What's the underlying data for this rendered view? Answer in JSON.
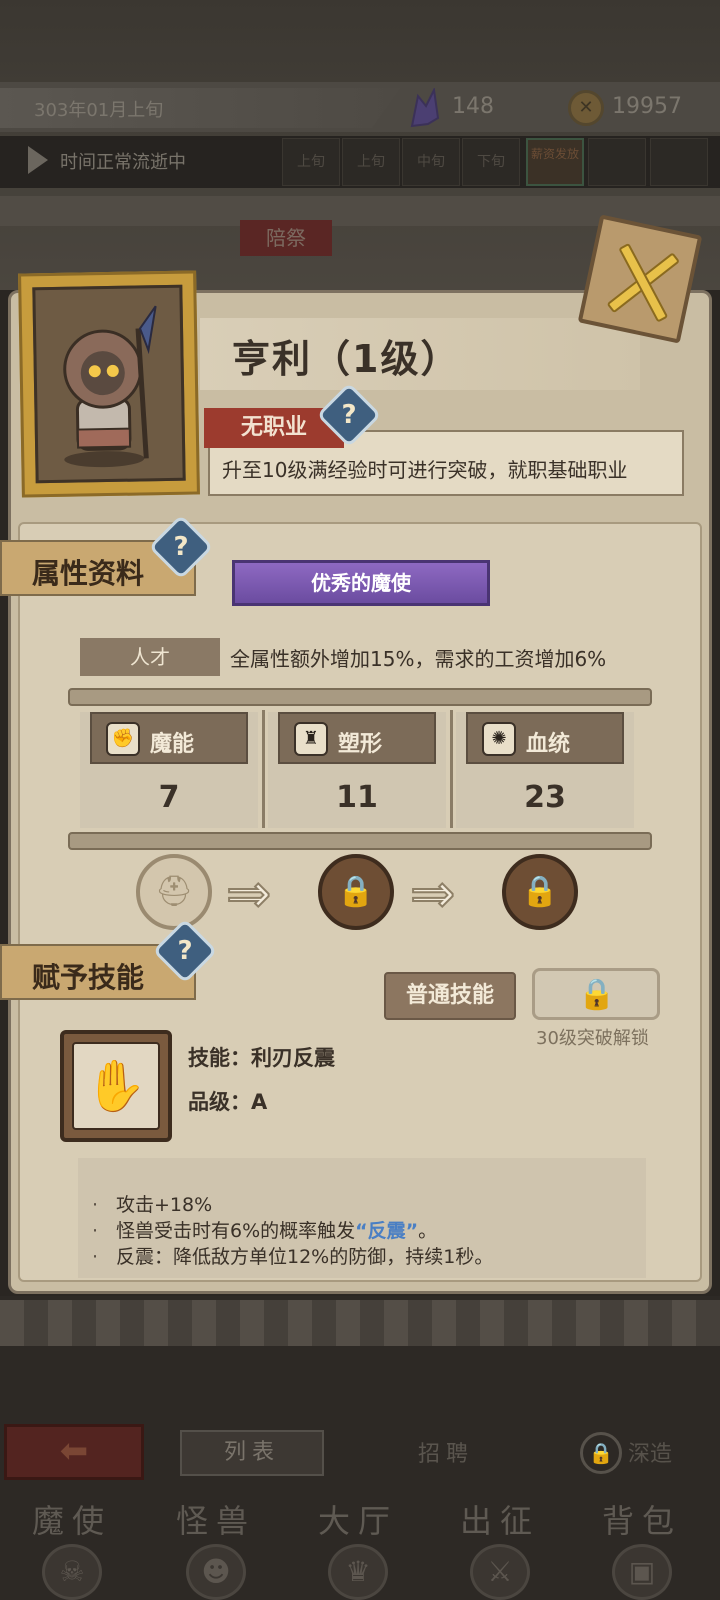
{
  "status_bar": {
    "date": "303年01月上旬",
    "crystals": "148",
    "coins": "19957",
    "coin_glyph": "✕"
  },
  "time_bar": {
    "status": "时间正常流逝中",
    "segments": [
      "上旬",
      "上旬",
      "中旬",
      "下旬"
    ],
    "highlight": "薪资发放"
  },
  "dim_tab": "陪祭",
  "character": {
    "name": "亨利（1级）",
    "job": "无职业",
    "job_desc": "升至10级满经验时可进行突破，就职基础职业"
  },
  "help_glyph": "?",
  "attributes": {
    "section_title": "属性资料",
    "rank_banner": "优秀的魔使",
    "talent_label": "人才",
    "talent_desc": "全属性额外增加15%，需求的工资增加6%",
    "stats": [
      {
        "name": "魔能",
        "value": "7",
        "icon": "claw-icon",
        "glyph": "✊"
      },
      {
        "name": "塑形",
        "value": "11",
        "icon": "body-icon",
        "glyph": "♜"
      },
      {
        "name": "血统",
        "value": "23",
        "icon": "blood-icon",
        "glyph": "✺"
      }
    ]
  },
  "evolution": {
    "current_glyph": "⛑",
    "locked_glyph": "🔒",
    "arrow_glyph": "⇒"
  },
  "skills": {
    "section_title": "赋予技能",
    "normal_tab": "普通技能",
    "locked_caption": "30级突破解锁",
    "lock_glyph": "🔒",
    "skill_icon_glyph": "✋",
    "skill_name_line": "技能：利刃反震",
    "grade_line": "品级：A",
    "effects": [
      {
        "pre": "攻击+18%",
        "kw": "",
        "post": ""
      },
      {
        "pre": "怪兽受击时有6%的概率触发",
        "kw": "“反震”",
        "post": "。"
      },
      {
        "pre": "反震：降低敌方单位12%的防御，持续1秒。",
        "kw": "",
        "post": ""
      }
    ],
    "bullet": "·"
  },
  "bottom": {
    "back_glyph": "⬅",
    "list": "列表",
    "recruit": "招聘",
    "deep": "深造",
    "deep_glyph": "🔒",
    "nav": [
      {
        "label": "魔使",
        "glyph": "☠"
      },
      {
        "label": "怪兽",
        "glyph": "☻"
      },
      {
        "label": "大厅",
        "glyph": "♛"
      },
      {
        "label": "出征",
        "glyph": "⚔"
      },
      {
        "label": "背包",
        "glyph": "▣"
      }
    ]
  },
  "colors": {
    "panel": "#c9bda3",
    "job_red": "#9c3b2e",
    "rank_purple": "#7a58b0",
    "keyword_blue": "#4a7fc4",
    "portrait_gold": "#c79c3d"
  }
}
